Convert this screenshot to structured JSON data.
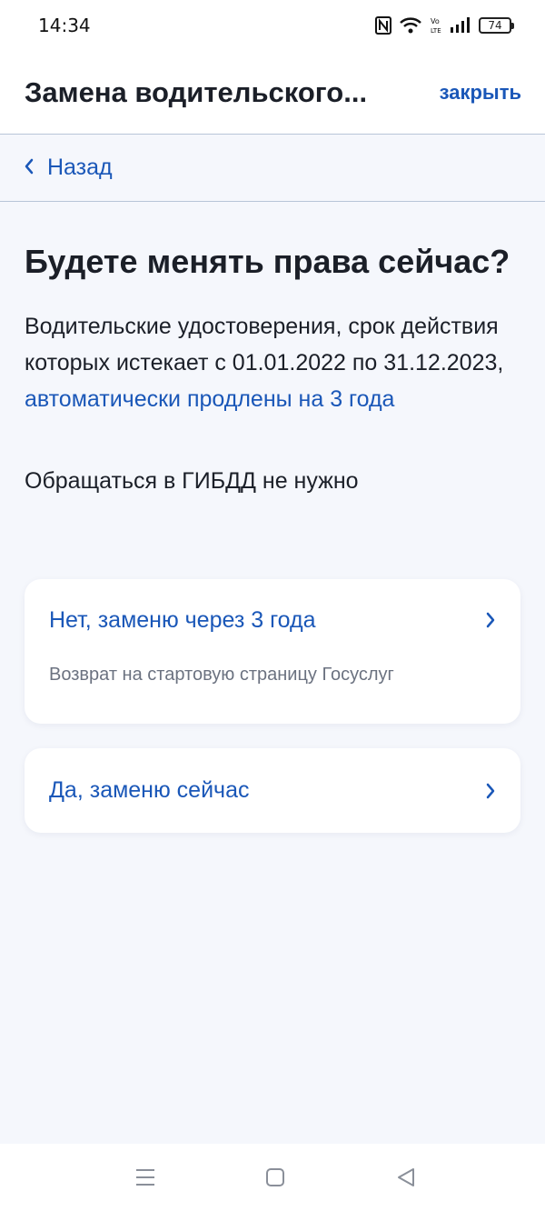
{
  "status_bar": {
    "time": "14:34",
    "battery": "74",
    "icons": [
      "nfc-icon",
      "wifi-icon",
      "volte-icon",
      "signal-icon",
      "battery-icon"
    ]
  },
  "app_bar": {
    "title": "Замена водительского...",
    "close_label": "закрыть"
  },
  "back": {
    "label": "Назад"
  },
  "main": {
    "heading": "Будете менять права сейчас?",
    "paragraph_text": "Водительские удостоверения, срок действия которых истекает с 01.01.2022 по 31.12.2023, ",
    "paragraph_link": "автоматически продлены на 3 года",
    "note": "Обращаться в ГИБДД не нужно"
  },
  "options": [
    {
      "title": "Нет, заменю через 3 года",
      "subtitle": "Возврат на стартовую страницу Госуслуг"
    },
    {
      "title": "Да, заменю сейчас"
    }
  ],
  "nav": {
    "icons": [
      "menu-icon",
      "home-icon",
      "back-icon"
    ]
  },
  "colors": {
    "accent": "#1a57b8",
    "background": "#f5f7fc",
    "text": "#1b1f28",
    "muted": "#6b7280"
  }
}
